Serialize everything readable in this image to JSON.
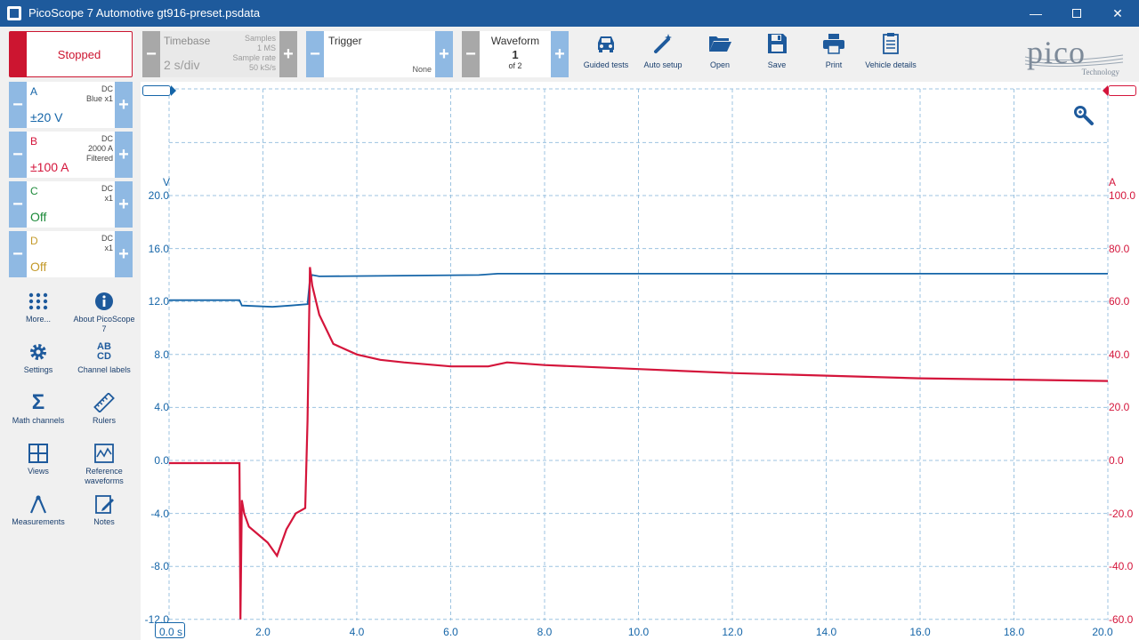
{
  "window": {
    "title": "PicoScope 7 Automotive gt916-preset.psdata",
    "minimize": "—",
    "close": "✕"
  },
  "run_status": "Stopped",
  "channels": [
    {
      "letter": "A",
      "coupling": "DC",
      "probe": "Blue x1",
      "range": "±20 V",
      "color": "#1565a8"
    },
    {
      "letter": "B",
      "coupling": "DC",
      "probe": "2000 A",
      "filter": "Filtered",
      "range": "±100 A",
      "color": "#d4153b"
    },
    {
      "letter": "C",
      "coupling": "DC",
      "probe": "x1",
      "range": "Off",
      "color": "#1d8a3a"
    },
    {
      "letter": "D",
      "coupling": "DC",
      "probe": "x1",
      "range": "Off",
      "color": "#c49a2a"
    }
  ],
  "sidebar_tools": [
    {
      "label": "More...",
      "icon": "more-grid-icon"
    },
    {
      "label": "About PicoScope 7",
      "icon": "info-icon"
    },
    {
      "label": "Settings",
      "icon": "gear-icon"
    },
    {
      "label": "Channel labels",
      "icon": "channel-labels-icon",
      "glyph": "AB\nCD"
    },
    {
      "label": "Math channels",
      "icon": "sigma-icon",
      "glyph": "Σ"
    },
    {
      "label": "Rulers",
      "icon": "ruler-icon"
    },
    {
      "label": "Views",
      "icon": "views-icon"
    },
    {
      "label": "Reference waveforms",
      "icon": "reference-waveform-icon"
    },
    {
      "label": "Measurements",
      "icon": "measurements-icon"
    },
    {
      "label": "Notes",
      "icon": "notes-icon"
    }
  ],
  "timebase": {
    "label": "Timebase",
    "value": "2 s/div",
    "samples_label": "Samples",
    "samples_value": "1 MS",
    "rate_label": "Sample rate",
    "rate_value": "50 kS/s"
  },
  "trigger": {
    "label": "Trigger",
    "mode": "None"
  },
  "waveform": {
    "label": "Waveform",
    "current": "1",
    "of_text": "of 2"
  },
  "step": {
    "minus": "−",
    "plus": "+"
  },
  "toolbar_buttons": [
    {
      "label": "Guided tests",
      "icon": "car-icon"
    },
    {
      "label": "Auto setup",
      "icon": "magic-wand-icon"
    },
    {
      "label": "Open",
      "icon": "folder-open-icon"
    },
    {
      "label": "Save",
      "icon": "save-icon"
    },
    {
      "label": "Print",
      "icon": "printer-icon"
    },
    {
      "label": "Vehicle details",
      "icon": "clipboard-icon"
    }
  ],
  "logo": {
    "word": "pico",
    "sub": "Technology",
    "icon": "pico-logo-icon"
  },
  "scope": {
    "left_unit": "V",
    "right_unit": "A",
    "left_ticks": [
      "20.0",
      "16.0",
      "12.0",
      "8.0",
      "4.0",
      "0.0",
      "-4.0",
      "-8.0",
      "-12.0"
    ],
    "right_ticks": [
      "100.0",
      "80.0",
      "60.0",
      "40.0",
      "20.0",
      "0.0",
      "-20.0",
      "-40.0",
      "-60.0"
    ],
    "x_ticks": [
      "0.0 s",
      "2.0",
      "4.0",
      "6.0",
      "8.0",
      "10.0",
      "12.0",
      "14.0",
      "16.0",
      "18.0",
      "20.0"
    ],
    "zoom_icon": "magnifier-icon"
  },
  "chart_data": {
    "type": "line",
    "x_unit": "s",
    "xlim": [
      0,
      20
    ],
    "series": [
      {
        "name": "A",
        "axis": "left",
        "unit": "V",
        "color": "#1565a8",
        "x": [
          0,
          1.5,
          1.55,
          2.2,
          2.6,
          2.95,
          3.0,
          3.05,
          3.2,
          6.6,
          7.0,
          20.0
        ],
        "y": [
          12.1,
          12.1,
          11.7,
          11.6,
          11.7,
          11.8,
          13.7,
          14.0,
          13.9,
          14.0,
          14.1,
          14.1
        ]
      },
      {
        "name": "B",
        "axis": "right",
        "unit": "A",
        "color": "#d4153b",
        "x": [
          0,
          1.5,
          1.52,
          1.55,
          1.6,
          1.7,
          1.9,
          2.1,
          2.3,
          2.5,
          2.7,
          2.9,
          2.95,
          3.0,
          3.05,
          3.2,
          3.5,
          4.0,
          4.5,
          5.0,
          6.0,
          6.8,
          7.2,
          8.0,
          10.0,
          12.0,
          14.0,
          16.0,
          18.0,
          20.0
        ],
        "y": [
          -1.0,
          -1.0,
          -60.0,
          -15.0,
          -20.0,
          -25.0,
          -28.0,
          -31.0,
          -36.0,
          -26.0,
          -20.0,
          -18.0,
          15.0,
          73.0,
          66.0,
          55.0,
          44.0,
          40.0,
          38.0,
          37.0,
          35.5,
          35.5,
          37.0,
          36.0,
          34.5,
          33.0,
          32.0,
          31.0,
          30.5,
          30.0
        ]
      }
    ]
  }
}
